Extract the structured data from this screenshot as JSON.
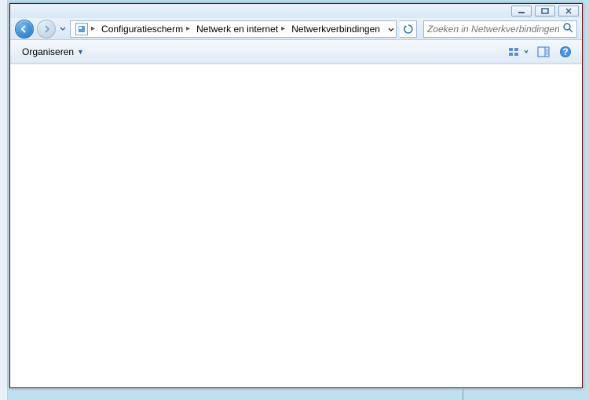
{
  "breadcrumb": {
    "seg1": "Configuratiescherm",
    "seg2": "Netwerk en internet",
    "seg3": "Netwerkverbindingen"
  },
  "search": {
    "placeholder": "Zoeken in Netwerkverbindingen"
  },
  "toolbar": {
    "organize": "Organiseren"
  }
}
